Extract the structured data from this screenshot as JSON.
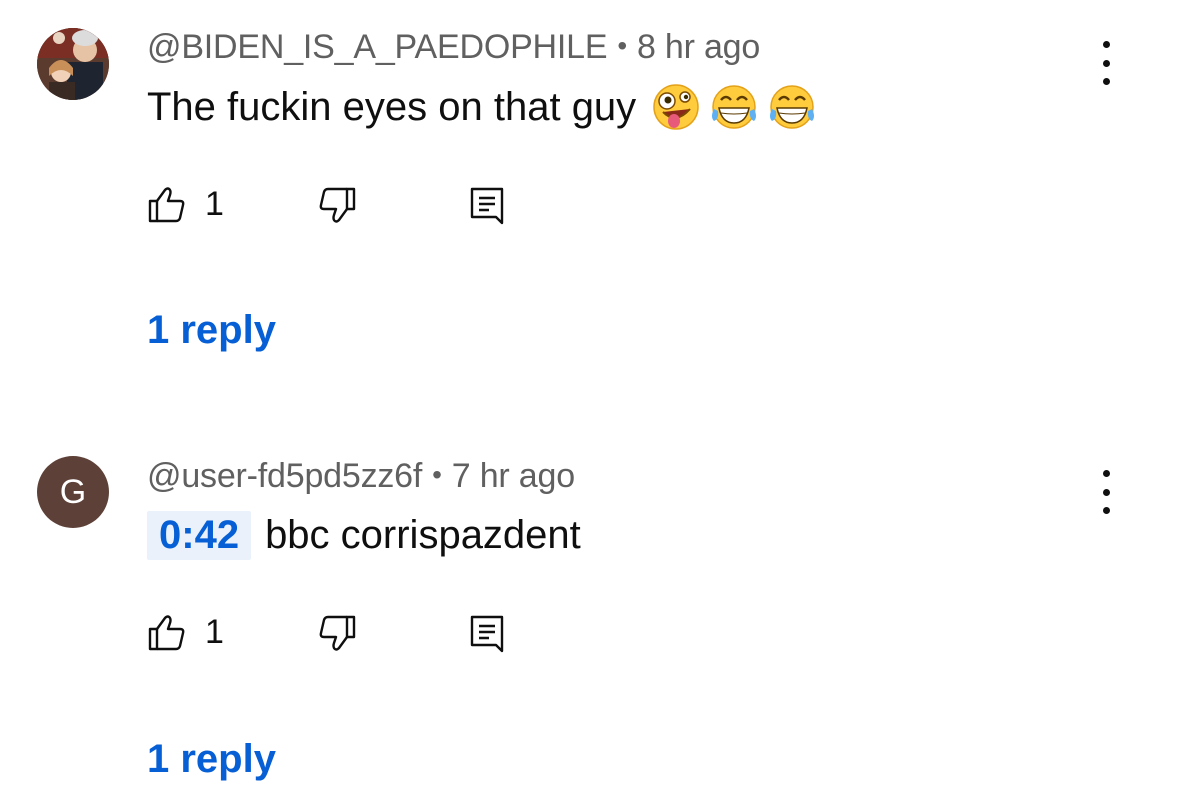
{
  "comments": [
    {
      "author": "@BIDEN_IS_A_PAEDOPHILE",
      "separator": "•",
      "time": "8 hr ago",
      "text": "The fuckin eyes on that guy",
      "emojis": [
        "zany-face-emoji",
        "tears-of-joy-emoji",
        "tears-of-joy-emoji"
      ],
      "likes": "1",
      "replies_label": "1 reply",
      "avatar": "photo"
    },
    {
      "author": "@user-fd5pd5zz6f",
      "separator": "•",
      "time": "7 hr ago",
      "timestamp_link": "0:42",
      "text": "bbc corrispazdent",
      "likes": "1",
      "replies_label": "1 reply",
      "avatar_letter": "G",
      "avatar_color": "#5d4037"
    }
  ],
  "colors": {
    "link_blue": "#065fd4",
    "meta_gray": "#606060",
    "timestamp_bg": "#eaf1fb"
  },
  "icons": {
    "like": "thumbs-up-icon",
    "dislike": "thumbs-down-icon",
    "reply": "comment-reply-icon",
    "more": "more-vertical-icon"
  }
}
